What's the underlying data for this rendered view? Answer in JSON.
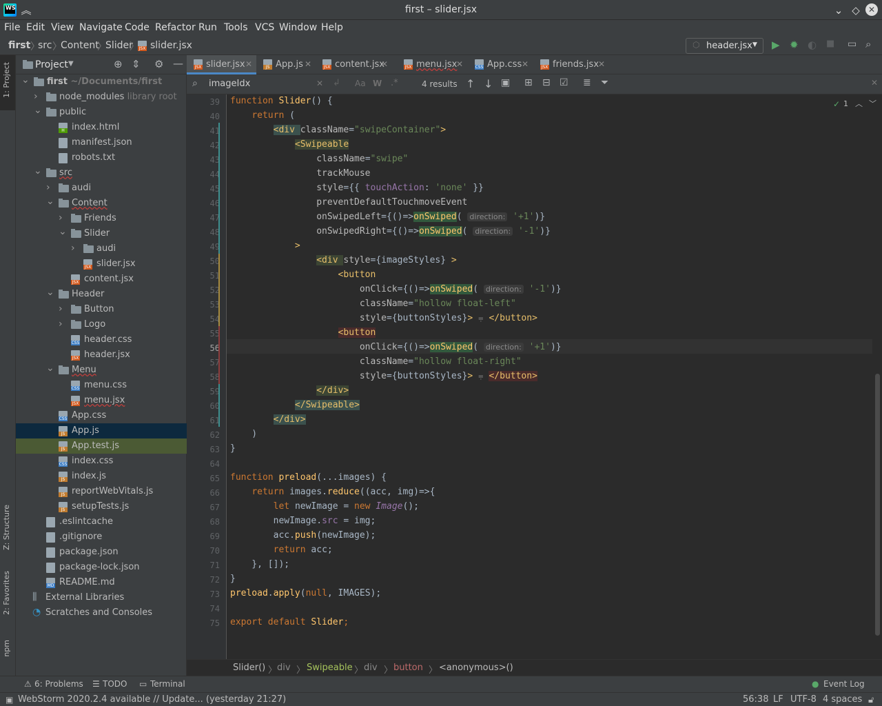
{
  "window": {
    "title": "first – slider.jsx",
    "app_logo": "WS"
  },
  "menu": [
    "File",
    "Edit",
    "View",
    "Navigate",
    "Code",
    "Refactor",
    "Run",
    "Tools",
    "VCS",
    "Window",
    "Help"
  ],
  "breadcrumbs": [
    "first",
    "src",
    "Content",
    "Slider",
    "slider.jsx"
  ],
  "run_config": "header.jsx",
  "left_tool_tabs": [
    "1: Project",
    "Z: Structure",
    "2: Favorites",
    "npm"
  ],
  "project_panel": {
    "title": "Project"
  },
  "tree": [
    {
      "label": "first",
      "hint": "~/Documents/first",
      "kind": "folder",
      "depth": 0,
      "open": true
    },
    {
      "label": "node_modules",
      "hint": "library root",
      "kind": "folder",
      "depth": 1,
      "open": false
    },
    {
      "label": "public",
      "kind": "folder",
      "depth": 1,
      "open": true
    },
    {
      "label": "index.html",
      "kind": "html",
      "depth": 2
    },
    {
      "label": "manifest.json",
      "kind": "file",
      "depth": 2
    },
    {
      "label": "robots.txt",
      "kind": "file",
      "depth": 2
    },
    {
      "label": "src",
      "kind": "folder",
      "depth": 1,
      "open": true
    },
    {
      "label": "audi",
      "kind": "folder",
      "depth": 2,
      "open": false
    },
    {
      "label": "Content",
      "kind": "folder",
      "depth": 2,
      "open": true
    },
    {
      "label": "Friends",
      "kind": "folder",
      "depth": 3,
      "open": false
    },
    {
      "label": "Slider",
      "kind": "folder",
      "depth": 3,
      "open": true
    },
    {
      "label": "audi",
      "kind": "folder",
      "depth": 4,
      "open": false
    },
    {
      "label": "slider.jsx",
      "kind": "jsx",
      "depth": 4
    },
    {
      "label": "content.jsx",
      "kind": "jsx",
      "depth": 3
    },
    {
      "label": "Header",
      "kind": "folder",
      "depth": 2,
      "open": true
    },
    {
      "label": "Button",
      "kind": "folder",
      "depth": 3,
      "open": false
    },
    {
      "label": "Logo",
      "kind": "folder",
      "depth": 3,
      "open": false
    },
    {
      "label": "header.css",
      "kind": "css",
      "depth": 3
    },
    {
      "label": "header.jsx",
      "kind": "jsx",
      "depth": 3
    },
    {
      "label": "Menu",
      "kind": "folder",
      "depth": 2,
      "open": true
    },
    {
      "label": "menu.css",
      "kind": "css",
      "depth": 3
    },
    {
      "label": "menu.jsx",
      "kind": "jsx",
      "depth": 3
    },
    {
      "label": "App.css",
      "kind": "css",
      "depth": 2
    },
    {
      "label": "App.js",
      "kind": "js",
      "depth": 2,
      "state": "selected"
    },
    {
      "label": "App.test.js",
      "kind": "js",
      "depth": 2,
      "state": "highlight"
    },
    {
      "label": "index.css",
      "kind": "css",
      "depth": 2
    },
    {
      "label": "index.js",
      "kind": "js",
      "depth": 2
    },
    {
      "label": "reportWebVitals.js",
      "kind": "js",
      "depth": 2
    },
    {
      "label": "setupTests.js",
      "kind": "js",
      "depth": 2
    },
    {
      "label": ".eslintcache",
      "kind": "file",
      "depth": 1
    },
    {
      "label": ".gitignore",
      "kind": "file",
      "depth": 1
    },
    {
      "label": "package.json",
      "kind": "file",
      "depth": 1
    },
    {
      "label": "package-lock.json",
      "kind": "file",
      "depth": 1
    },
    {
      "label": "README.md",
      "kind": "md",
      "depth": 1
    },
    {
      "label": "External Libraries",
      "kind": "lib",
      "depth": 0
    },
    {
      "label": "Scratches and Consoles",
      "kind": "scratch",
      "depth": 0
    }
  ],
  "tabs": [
    {
      "label": "slider.jsx",
      "kind": "jsx",
      "active": true
    },
    {
      "label": "App.js",
      "kind": "js"
    },
    {
      "label": "content.jsx",
      "kind": "jsx"
    },
    {
      "label": "menu.jsx",
      "kind": "jsx"
    },
    {
      "label": "App.css",
      "kind": "css"
    },
    {
      "label": "friends.jsx",
      "kind": "jsx"
    }
  ],
  "find": {
    "query": "imageIdx",
    "results": "4 results"
  },
  "inspection": {
    "count": "1"
  },
  "code_lines": [
    {
      "n": "39",
      "segs": [
        [
          "kw",
          "function "
        ],
        [
          "fn",
          "Slider"
        ],
        [
          "",
          "() {"
        ]
      ]
    },
    {
      "n": "40",
      "segs": [
        [
          "",
          "    "
        ],
        [
          "kw",
          "return "
        ],
        [
          "",
          "("
        ]
      ]
    },
    {
      "n": "41",
      "segs": [
        [
          "",
          "        "
        ],
        [
          "tagbox",
          "<div "
        ],
        [
          "attr",
          "className"
        ],
        [
          "",
          "="
        ],
        [
          "str",
          "\"swipeContainer\""
        ],
        [
          "tag",
          ">"
        ]
      ]
    },
    {
      "n": "42",
      "segs": [
        [
          "",
          "            "
        ],
        [
          "tagbox2",
          "<Swipeable"
        ]
      ]
    },
    {
      "n": "43",
      "segs": [
        [
          "",
          "                "
        ],
        [
          "attr",
          "className"
        ],
        [
          "",
          "="
        ],
        [
          "str",
          "\"swipe\""
        ]
      ]
    },
    {
      "n": "44",
      "segs": [
        [
          "",
          "                "
        ],
        [
          "attr",
          "trackMouse"
        ]
      ]
    },
    {
      "n": "45",
      "segs": [
        [
          "",
          "                "
        ],
        [
          "attr",
          "style"
        ],
        [
          "",
          "={{ "
        ],
        [
          "cls2",
          "touchAction"
        ],
        [
          "",
          ": "
        ],
        [
          "str",
          "'none'"
        ],
        [
          "",
          " }}"
        ]
      ]
    },
    {
      "n": "46",
      "segs": [
        [
          "",
          "                "
        ],
        [
          "attr",
          "preventDefaultTouchmoveEvent"
        ]
      ]
    },
    {
      "n": "47",
      "segs": [
        [
          "",
          "                "
        ],
        [
          "attr",
          "onSwipedLeft"
        ],
        [
          "",
          "={()=>"
        ],
        [
          "hlfn",
          "onSwiped"
        ],
        [
          "",
          "( "
        ],
        [
          "ph",
          "direction:"
        ],
        [
          "",
          " "
        ],
        [
          "str",
          "'+1'"
        ],
        [
          "",
          ")}"
        ]
      ]
    },
    {
      "n": "48",
      "segs": [
        [
          "",
          "                "
        ],
        [
          "attr",
          "onSwipedRight"
        ],
        [
          "",
          "={()=>"
        ],
        [
          "hlfn",
          "onSwiped"
        ],
        [
          "",
          "( "
        ],
        [
          "ph",
          "direction:"
        ],
        [
          "",
          " "
        ],
        [
          "str",
          "'-1'"
        ],
        [
          "",
          ")}"
        ]
      ]
    },
    {
      "n": "49",
      "segs": [
        [
          "",
          "            "
        ],
        [
          "tag",
          ">"
        ]
      ]
    },
    {
      "n": "50",
      "segs": [
        [
          "",
          "                "
        ],
        [
          "tagbox2",
          "<div "
        ],
        [
          "attr",
          "style"
        ],
        [
          "",
          "={imageStyles} "
        ],
        [
          "tag",
          ">"
        ]
      ]
    },
    {
      "n": "51",
      "segs": [
        [
          "",
          "                    "
        ],
        [
          "tag",
          "<button"
        ]
      ]
    },
    {
      "n": "52",
      "segs": [
        [
          "",
          "                        "
        ],
        [
          "attr",
          "onClick"
        ],
        [
          "",
          "={()=>"
        ],
        [
          "hlfn",
          "onSwiped"
        ],
        [
          "",
          "( "
        ],
        [
          "ph",
          "direction:"
        ],
        [
          "",
          " "
        ],
        [
          "str",
          "'-1'"
        ],
        [
          "",
          ")}"
        ]
      ]
    },
    {
      "n": "53",
      "segs": [
        [
          "",
          "                        "
        ],
        [
          "attr",
          "className"
        ],
        [
          "",
          "="
        ],
        [
          "str",
          "\"hollow float-left\""
        ]
      ]
    },
    {
      "n": "54",
      "segs": [
        [
          "",
          "                        "
        ],
        [
          "attr",
          "style"
        ],
        [
          "",
          "={buttonStyles}"
        ],
        [
          "tag",
          "> "
        ],
        [
          "hint",
          "⩦ "
        ],
        [
          "tag",
          "</button>"
        ]
      ]
    },
    {
      "n": "55",
      "segs": [
        [
          "",
          "                    "
        ],
        [
          "tagred",
          "<button"
        ]
      ]
    },
    {
      "n": "56",
      "segs": [
        [
          "",
          "                        "
        ],
        [
          "attr",
          "onClick"
        ],
        [
          "",
          "={()=>"
        ],
        [
          "hlfn",
          "onSwiped"
        ],
        [
          "",
          "( "
        ],
        [
          "ph",
          "direction:"
        ],
        [
          "",
          " "
        ],
        [
          "str",
          "'+1'"
        ],
        [
          "",
          ")}"
        ]
      ]
    },
    {
      "n": "57",
      "segs": [
        [
          "",
          "                        "
        ],
        [
          "attr",
          "className"
        ],
        [
          "",
          "="
        ],
        [
          "str",
          "\"hollow float-right\""
        ]
      ]
    },
    {
      "n": "58",
      "segs": [
        [
          "",
          "                        "
        ],
        [
          "attr",
          "style"
        ],
        [
          "",
          "={buttonStyles}"
        ],
        [
          "tag",
          "> "
        ],
        [
          "hint",
          "⩦ "
        ],
        [
          "tagred",
          "</button>"
        ]
      ]
    },
    {
      "n": "59",
      "segs": [
        [
          "",
          "                "
        ],
        [
          "tagbox2",
          "</div>"
        ]
      ]
    },
    {
      "n": "60",
      "segs": [
        [
          "",
          "            "
        ],
        [
          "tagbox",
          "</Swipeable>"
        ]
      ]
    },
    {
      "n": "61",
      "segs": [
        [
          "",
          "        "
        ],
        [
          "tagbox",
          "</div>"
        ]
      ]
    },
    {
      "n": "62",
      "segs": [
        [
          "",
          "    )"
        ]
      ]
    },
    {
      "n": "63",
      "segs": [
        [
          "",
          "}"
        ]
      ]
    },
    {
      "n": "64",
      "segs": [
        [
          "",
          ""
        ]
      ]
    },
    {
      "n": "65",
      "segs": [
        [
          "kw",
          "function "
        ],
        [
          "fn",
          "preload"
        ],
        [
          "",
          "(...images) {"
        ]
      ]
    },
    {
      "n": "66",
      "segs": [
        [
          "",
          "    "
        ],
        [
          "kw",
          "return "
        ],
        [
          "",
          "images."
        ],
        [
          "fn",
          "reduce"
        ],
        [
          "",
          "((acc, img)=>{"
        ]
      ]
    },
    {
      "n": "67",
      "segs": [
        [
          "",
          "        "
        ],
        [
          "kw",
          "let "
        ],
        [
          "",
          "newImage = "
        ],
        [
          "kw",
          "new "
        ],
        [
          "cls",
          "Image"
        ],
        [
          "",
          "();"
        ]
      ]
    },
    {
      "n": "68",
      "segs": [
        [
          "",
          "        newImage."
        ],
        [
          "cls2",
          "src"
        ],
        [
          "",
          " = img;"
        ]
      ]
    },
    {
      "n": "69",
      "segs": [
        [
          "",
          "        acc."
        ],
        [
          "fn",
          "push"
        ],
        [
          "",
          "(newImage);"
        ]
      ]
    },
    {
      "n": "70",
      "segs": [
        [
          "",
          "        "
        ],
        [
          "kw",
          "return "
        ],
        [
          "",
          "acc;"
        ]
      ]
    },
    {
      "n": "71",
      "segs": [
        [
          "",
          "    }, []);"
        ]
      ]
    },
    {
      "n": "72",
      "segs": [
        [
          "",
          "}"
        ]
      ]
    },
    {
      "n": "73",
      "segs": [
        [
          "fn",
          "preload"
        ],
        [
          "",
          "."
        ],
        [
          "fn",
          "apply"
        ],
        [
          "",
          "("
        ],
        [
          "kw",
          "null"
        ],
        [
          "",
          ", IMAGES);"
        ]
      ]
    },
    {
      "n": "74",
      "segs": [
        [
          "",
          ""
        ]
      ]
    },
    {
      "n": "75",
      "segs": [
        [
          "kw",
          "export default "
        ],
        [
          "fn",
          "Slider"
        ],
        [
          "kw",
          ";"
        ]
      ]
    }
  ],
  "editor_breadcrumb": [
    "Slider()",
    "div",
    "Swipeable",
    "div",
    "button",
    "<anonymous>()"
  ],
  "tool_windows": [
    {
      "label": "6: Problems",
      "icon": "problems-icon"
    },
    {
      "label": "TODO",
      "icon": "todo-icon"
    },
    {
      "label": "Terminal",
      "icon": "terminal-icon"
    }
  ],
  "event_log": "Event Log",
  "status": {
    "message": "WebStorm 2020.2.4 available // Update... (yesterday 21:27)",
    "position": "56:38",
    "line_sep": "LF",
    "encoding": "UTF-8",
    "indent": "4 spaces"
  },
  "colors": {
    "accent": "#4a88c7",
    "panel": "#3c3f41",
    "editor": "#2b2b2b",
    "selection": "#0d293e"
  }
}
